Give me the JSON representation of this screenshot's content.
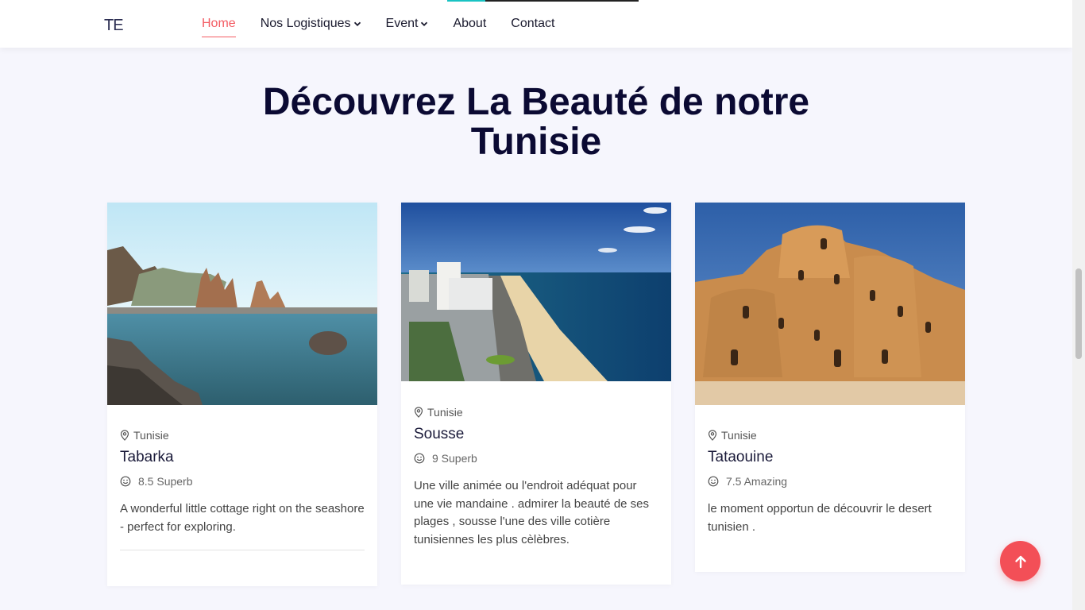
{
  "header": {
    "logo_text": "TE",
    "nav": [
      {
        "label": "Home",
        "active": true,
        "dropdown": false
      },
      {
        "label": "Nos Logistiques",
        "active": false,
        "dropdown": true
      },
      {
        "label": "Event",
        "active": false,
        "dropdown": true
      },
      {
        "label": "About",
        "active": false,
        "dropdown": false
      },
      {
        "label": "Contact",
        "active": false,
        "dropdown": false
      }
    ],
    "accent_color": "#f35b62"
  },
  "section": {
    "title_line1": "Découvrez La Beauté de notre",
    "title_line2": "Tunisie"
  },
  "cards": [
    {
      "location": "Tunisie",
      "name": "Tabarka",
      "rating": "8.5 Superb",
      "description": "A wonderful little cottage right on the seashore - perfect for exploring."
    },
    {
      "location": "Tunisie",
      "name": "Sousse",
      "rating": "9 Superb",
      "description": "Une ville animée ou l'endroit adéquat pour une vie mandaine . admirer la beauté de ses plages , sousse l'une des ville cotière tunisiennes les plus cèlèbres."
    },
    {
      "location": "Tunisie",
      "name": "Tataouine",
      "rating": "7.5 Amazing",
      "description": "le moment opportun de découvrir le desert tunisien ."
    }
  ],
  "icons": {
    "location": "map-pin-icon",
    "rating": "smiley-icon",
    "to_top": "arrow-up-icon"
  },
  "colors": {
    "background": "#f6f6fd",
    "title": "#0b0a33",
    "to_top_button": "#f34f57"
  }
}
